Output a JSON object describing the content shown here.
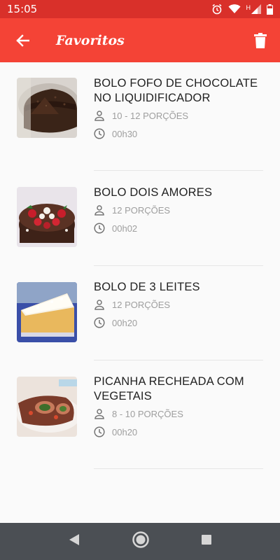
{
  "status_bar": {
    "time": "15:05",
    "network_label": "H"
  },
  "app_bar": {
    "title": "Favoritos"
  },
  "recipes": [
    {
      "title": "BOLO FOFO DE CHOCOLATE NO LIQUIDIFICADOR",
      "servings": "10 - 12 PORÇÕES",
      "time": "00h30"
    },
    {
      "title": "BOLO DOIS AMORES",
      "servings": "12 PORÇÕES",
      "time": "00h02"
    },
    {
      "title": "BOLO DE 3 LEITES",
      "servings": "12 PORÇÕES",
      "time": "00h20"
    },
    {
      "title": "PICANHA RECHEADA COM VEGETAIS",
      "servings": "8 - 10 PORÇÕES",
      "time": "00h20"
    }
  ],
  "colors": {
    "status_bar": "#d9302a",
    "app_bar": "#f44336",
    "nav_bar": "#4b4f54"
  },
  "icons": {
    "back": "arrow-left-icon",
    "delete": "trash-icon",
    "servings": "person-icon",
    "time": "clock-icon"
  }
}
